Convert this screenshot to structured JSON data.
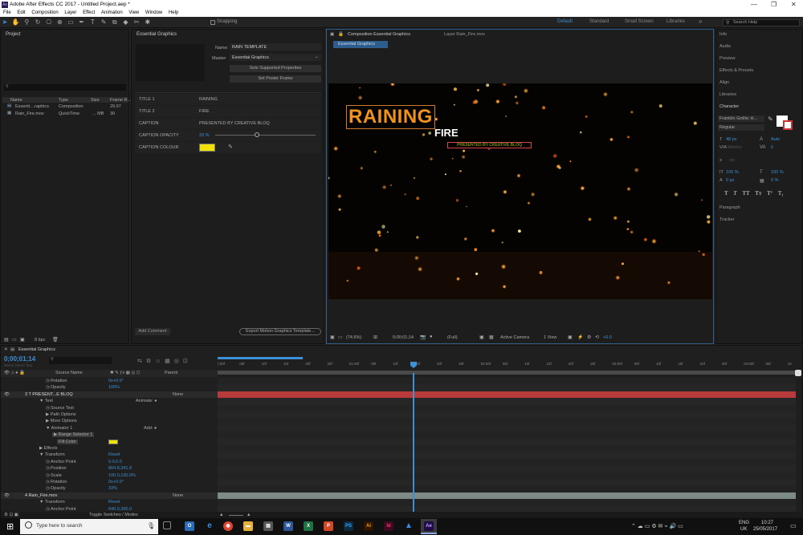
{
  "window": {
    "title": "Adobe After Effects CC 2017 - Untitled Project.aep *"
  },
  "menu": [
    "File",
    "Edit",
    "Composition",
    "Layer",
    "Effect",
    "Animation",
    "View",
    "Window",
    "Help"
  ],
  "toolbar": {
    "snapping": "Snapping",
    "workspaces": [
      "Default",
      "Standard",
      "Small Screen",
      "Libraries"
    ],
    "search_placeholder": "Search Help"
  },
  "project": {
    "tab": "Project",
    "columns": [
      "Name",
      "Type",
      "Size",
      "Frame R..."
    ],
    "items": [
      {
        "name": "Essenti....raphics",
        "type": "Composition",
        "size": "",
        "rate": "29.97"
      },
      {
        "name": "Rain_Fire.mov",
        "type": "QuickTime",
        "size": "... MB",
        "rate": "30"
      }
    ],
    "bpc": "8 bpc"
  },
  "eg": {
    "tab": "Essential Graphics",
    "name_label": "Name:",
    "name_value": "RAIN TEMPLATE",
    "master_label": "Master:",
    "master_value": "Essential Graphics",
    "solo_btn": "Solo Supported Properties",
    "poster_btn": "Set Poster Frame",
    "props": [
      {
        "label": "TITLE 1",
        "value": "RAINING"
      },
      {
        "label": "TITLE 2",
        "value": "FIRE"
      },
      {
        "label": "CAPTION",
        "value": "PRESENTED BY CREATIVE BLOQ"
      },
      {
        "label": "CAPTION OPACITY",
        "value": "33 %"
      },
      {
        "label": "CAPTION COLOUR",
        "value": ""
      }
    ],
    "caption_colour": "#f2e200",
    "add_comment": "Add Comment",
    "export_btn": "Export Motion Graphics Template..."
  },
  "viewer": {
    "tab_comp": "Composition Essential Graphics",
    "tab_layer": "Layer Rain_Fire.mov",
    "subtab": "Essential Graphics",
    "title1": "RAINING",
    "title2": "FIRE",
    "caption": "PRESENTED BY CREATIVE BLOQ",
    "zoom": "(74.6%)",
    "timecode": "0;00;01;14",
    "res": "(Full)",
    "camera": "Active Camera",
    "view": "1 View",
    "exposure": "+0.0"
  },
  "right": {
    "items": [
      "Info",
      "Audio",
      "Preview",
      "Effects & Presets",
      "Align",
      "Libraries"
    ],
    "character": "Character",
    "font": "Franklin Gothic H...",
    "style": "Regular",
    "size": "48 px",
    "leading": "Auto",
    "kerning": "Metrics",
    "tracking": "0",
    "stroke": "- px",
    "vscale": "100 %",
    "hscale": "100 %",
    "baseline": "0 px",
    "tsume": "0 %",
    "lower": [
      "Paragraph",
      "Tracker"
    ]
  },
  "timeline": {
    "tab": "Essential Graphics",
    "timecode": "0;00;01;14",
    "timecode_sub": "00044 (29.97 fps)",
    "ruler": [
      "):00f",
      "05f",
      "10f",
      "15f",
      "20f",
      "25f",
      "01:00f",
      "05f",
      "10f",
      "15f",
      "20f",
      "25f",
      "02:00f",
      "05f",
      "10f",
      "15f",
      "20f",
      "25f",
      "03:00f",
      "05f",
      "10f",
      "15f",
      "20f",
      "25f",
      "04:00f",
      "05f",
      "10"
    ],
    "col_source": "Source Name",
    "col_parent": "Parent",
    "rows": [
      {
        "indent": 62,
        "label": "Rotation",
        "value": "0x+0.0°"
      },
      {
        "indent": 62,
        "label": "Opacity",
        "value": "100%"
      },
      {
        "indent": 30,
        "label": "3  T  PRESENT...E BLOQ",
        "value": "None",
        "layer": true
      },
      {
        "indent": 48,
        "label": "▼ Text",
        "value": "Animate: ●"
      },
      {
        "indent": 62,
        "label": "Source Text",
        "value": ""
      },
      {
        "indent": 56,
        "label": "▶ Path Options",
        "value": ""
      },
      {
        "indent": 56,
        "label": "▶ More Options",
        "value": ""
      },
      {
        "indent": 56,
        "label": "▼ Animator 1",
        "value": "Add: ●"
      },
      {
        "indent": 64,
        "label": "▶ Range Selector 1",
        "value": "",
        "sel": true
      },
      {
        "indent": 70,
        "label": "Fill Color",
        "value": "",
        "sel": true
      },
      {
        "indent": 48,
        "label": "▶ Effects",
        "value": ""
      },
      {
        "indent": 48,
        "label": "▼ Transform",
        "value": "Reset"
      },
      {
        "indent": 62,
        "label": "Anchor Point",
        "value": "0.0,0.0"
      },
      {
        "indent": 62,
        "label": "Position",
        "value": "804.8,341.9"
      },
      {
        "indent": 62,
        "label": "Scale",
        "value": "100.0,100.0%"
      },
      {
        "indent": 62,
        "label": "Rotation",
        "value": "0x+0.0°"
      },
      {
        "indent": 62,
        "label": "Opacity",
        "value": "33%"
      },
      {
        "indent": 30,
        "label": "4     Rain_Fire.mov",
        "value": "None",
        "layer": true
      },
      {
        "indent": 48,
        "label": "▼ Transform",
        "value": "Reset"
      },
      {
        "indent": 62,
        "label": "Anchor Point",
        "value": "640.0,360.0"
      }
    ],
    "toggle": "Toggle Switches / Modes"
  },
  "taskbar": {
    "search": "Type here to search",
    "lang": "ENG",
    "region": "UK",
    "time": "10:27",
    "date": "25/05/2017",
    "apps": [
      "PS",
      "Ai",
      "Id",
      "Ae",
      "W",
      "X",
      "P"
    ]
  },
  "colors": {
    "accent": "#3d8fd6",
    "layer_red": "#b83a3a",
    "layer_grey": "#7d8a87",
    "title_orange": "#f0931c"
  }
}
